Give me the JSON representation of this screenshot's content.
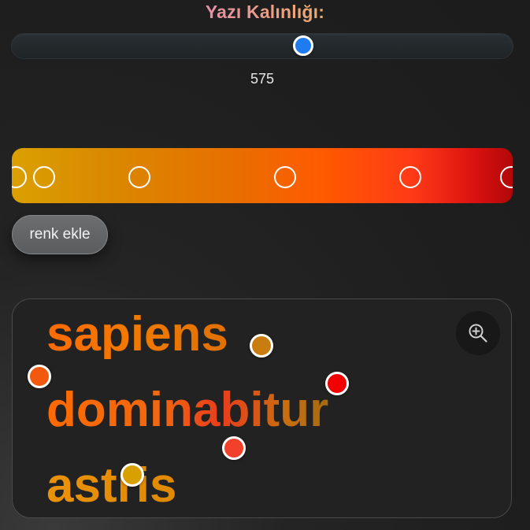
{
  "title": "Yazı Kalınlığı:",
  "slider": {
    "value": "575",
    "position_fraction": 0.585
  },
  "gradient": {
    "stops": [
      {
        "color": "#d8a000",
        "fraction": 0.0
      },
      {
        "color": "#dba000",
        "fraction": 0.065
      },
      {
        "color": "#d98a00",
        "fraction": 0.255
      },
      {
        "color": "#ff5a00",
        "fraction": 0.545
      },
      {
        "color": "#ff3a16",
        "fraction": 0.795
      },
      {
        "color": "#b00808",
        "fraction": 1.0
      }
    ]
  },
  "add_color_button": {
    "label": "renk ekle"
  },
  "preview": {
    "words": [
      "sapiens",
      "dominabitur",
      "astris"
    ],
    "zoom_icon": "zoom-in-icon"
  },
  "handle_colors": [
    "#c97d10",
    "#f2590e",
    "#f00000",
    "#f3402b",
    "#d8a000"
  ],
  "accent_color": "#1f7cf0"
}
